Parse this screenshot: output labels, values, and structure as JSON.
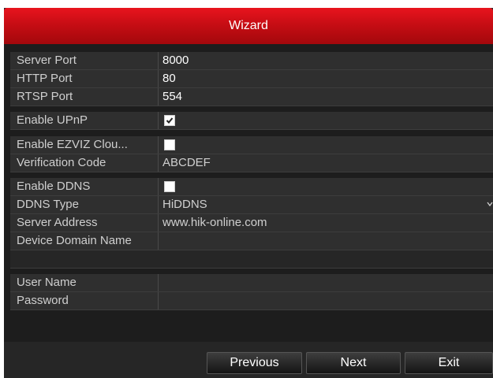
{
  "title": "Wizard",
  "network": {
    "server_port_label": "Server Port",
    "server_port_value": "8000",
    "http_port_label": "HTTP Port",
    "http_port_value": "80",
    "rtsp_port_label": "RTSP Port",
    "rtsp_port_value": "554"
  },
  "upnp": {
    "label": "Enable UPnP",
    "checked": true
  },
  "ezviz": {
    "enable_label": "Enable EZVIZ Clou...",
    "checked": false,
    "verification_label": "Verification Code",
    "verification_value": "ABCDEF"
  },
  "ddns": {
    "enable_label": "Enable DDNS",
    "checked": false,
    "type_label": "DDNS Type",
    "type_value": "HiDDNS",
    "server_label": "Server Address",
    "server_value": "www.hik-online.com",
    "domain_label": "Device Domain Name",
    "domain_value": ""
  },
  "account": {
    "username_label": "User Name",
    "username_value": "",
    "password_label": "Password",
    "password_value": ""
  },
  "buttons": {
    "previous": "Previous",
    "next": "Next",
    "exit": "Exit"
  },
  "colors": {
    "title_red": "#c70d14",
    "panel_bg": "#1d1d1d",
    "row_bg": "#2f2f2f"
  }
}
